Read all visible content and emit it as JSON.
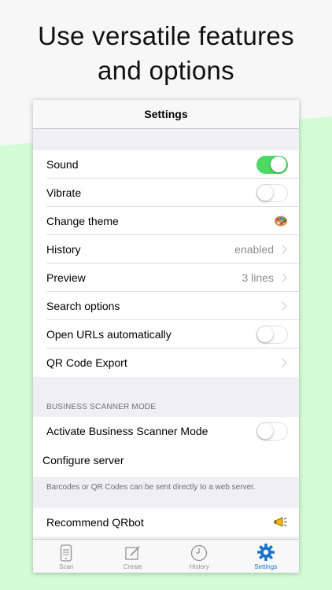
{
  "headline": {
    "line1": "Use versatile features",
    "line2": "and options"
  },
  "navbar": {
    "title": "Settings"
  },
  "settings": {
    "sound": "Sound",
    "vibrate": "Vibrate",
    "change_theme": "Change theme",
    "history": {
      "label": "History",
      "value": "enabled"
    },
    "preview": {
      "label": "Preview",
      "value": "3 lines"
    },
    "search_options": "Search options",
    "open_urls": "Open URLs automatically",
    "qr_export": "QR Code Export"
  },
  "toggles": {
    "sound": true,
    "vibrate": false,
    "open_urls": false,
    "business_mode": false
  },
  "business": {
    "header": "BUSINESS SCANNER MODE",
    "activate": "Activate Business Scanner Mode",
    "configure": "Configure server",
    "footer": "Barcodes or QR Codes can be sent directly to a web server."
  },
  "recommend": {
    "label": "Recommend QRbot"
  },
  "tabbar": {
    "tabs": [
      {
        "label": "Scan",
        "icon": "phone-scan-icon"
      },
      {
        "label": "Create",
        "icon": "edit-icon"
      },
      {
        "label": "History",
        "icon": "clock-icon"
      },
      {
        "label": "Settings",
        "icon": "gear-icon"
      }
    ],
    "active": "Settings"
  },
  "colors": {
    "accent": "#1a73c8",
    "toggle_on": "#4cd964",
    "background_green": "#d4fdd6"
  }
}
